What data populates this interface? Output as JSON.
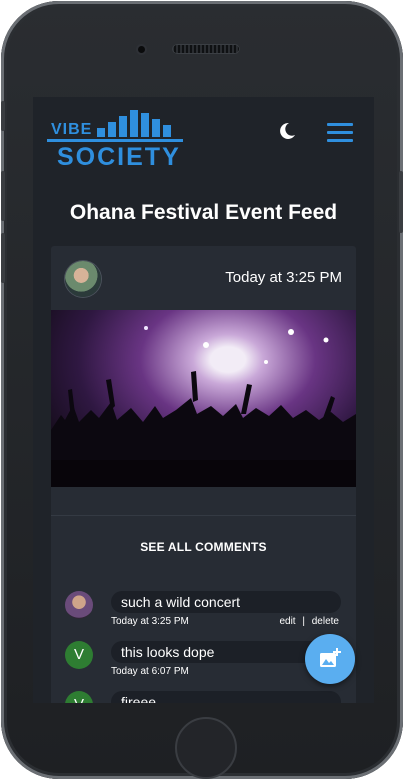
{
  "brand": {
    "logo_top": "VIBE",
    "logo_bottom": "SOCIETY"
  },
  "page": {
    "title": "Ohana Festival Event Feed"
  },
  "post": {
    "time": "Today at 3:25 PM",
    "see_all_label": "SEE ALL COMMENTS"
  },
  "comments": [
    {
      "avatar_letter": "",
      "text": "such a wild concert",
      "time": "Today at 3:25 PM",
      "edit": "edit",
      "sep": "|",
      "delete": "delete"
    },
    {
      "avatar_letter": "V",
      "text": "this looks dope",
      "time": "Today at 6:07 PM"
    },
    {
      "avatar_letter": "V",
      "text": "fireee"
    }
  ],
  "colors": {
    "accent": "#2f8fde",
    "fab": "#5aaef0",
    "avatar_green": "#2e7d32",
    "screen_bg": "#1f2329",
    "card_bg": "#272c34"
  },
  "icons": {
    "theme_toggle": "moon-icon",
    "menu": "hamburger-menu-icon",
    "fab": "add-photo-icon"
  }
}
